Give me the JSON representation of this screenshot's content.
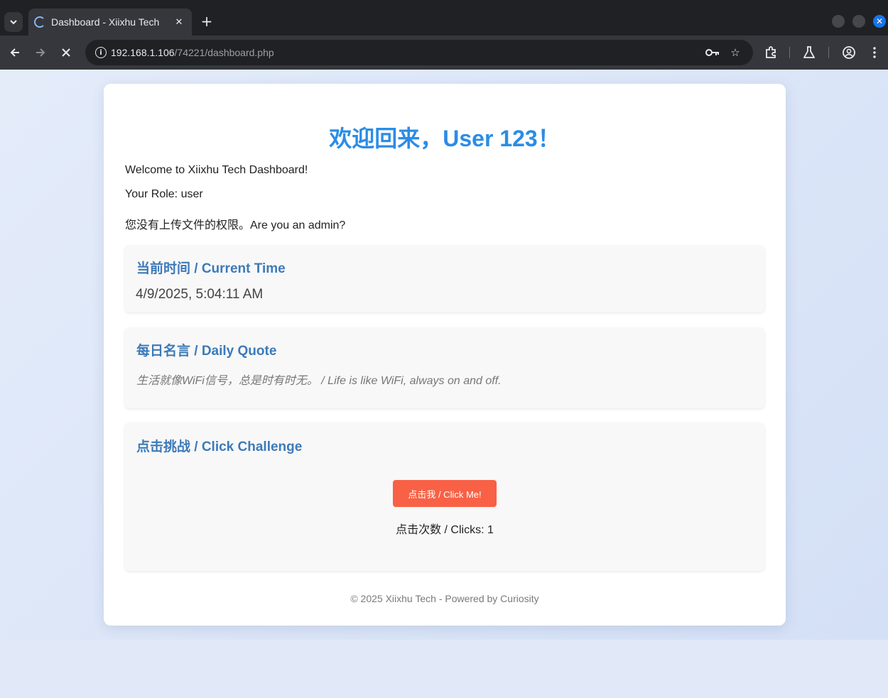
{
  "browser": {
    "tab_title": "Dashboard - Xiixhu Tech",
    "url_host": "192.168.1.106",
    "url_path": "/74221/dashboard.php"
  },
  "page": {
    "welcome_title": "欢迎回来，User 123！",
    "welcome_text": "Welcome to Xiixhu Tech Dashboard!",
    "role_text": "Your Role: user",
    "permission_text": "您没有上传文件的权限。Are you an admin?",
    "time_card": {
      "title": "当前时间 / Current Time",
      "value": "4/9/2025, 5:04:11 AM"
    },
    "quote_card": {
      "title": "每日名言 / Daily Quote",
      "quote": "生活就像WiFi信号，总是时有时无。 / Life is like WiFi, always on and off."
    },
    "challenge_card": {
      "title": "点击挑战 / Click Challenge",
      "button_label": "点击我 / Click Me!",
      "clicks_text": "点击次数 / Clicks: 1"
    },
    "footer": "© 2025 Xiixhu Tech - Powered by Curiosity"
  },
  "colors": {
    "title_blue": "#2b8ce6",
    "card_title_blue": "#3d7ab8",
    "button_red": "#f86145"
  }
}
